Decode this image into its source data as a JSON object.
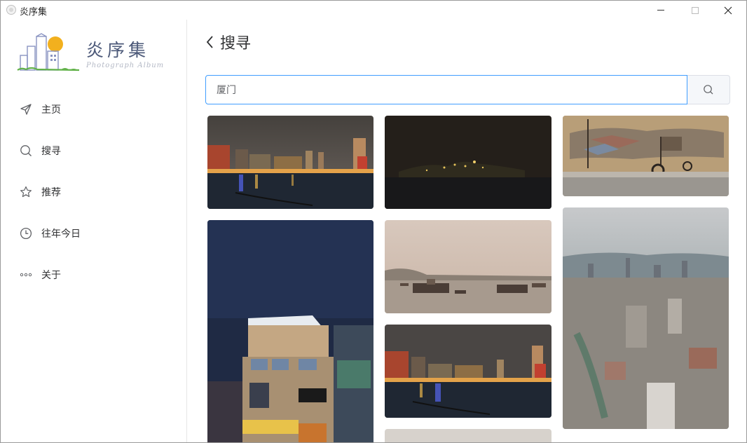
{
  "window": {
    "title": "炎序集",
    "controls": [
      "minimize",
      "maximize",
      "close"
    ]
  },
  "logo": {
    "title": "炎序集",
    "subtitle": "Photograph Album"
  },
  "sidebar": {
    "items": [
      {
        "label": "主页",
        "icon": "send-icon"
      },
      {
        "label": "搜寻",
        "icon": "search-icon"
      },
      {
        "label": "推荐",
        "icon": "star-icon"
      },
      {
        "label": "往年今日",
        "icon": "clock-icon"
      },
      {
        "label": "关于",
        "icon": "more-dots-icon"
      }
    ]
  },
  "header": {
    "back_label": "搜寻"
  },
  "search": {
    "value": "厦门",
    "placeholder": ""
  },
  "photos": [
    {
      "subject": "night harbor with lit buildings"
    },
    {
      "subject": "dark night island skyline"
    },
    {
      "subject": "stone relief wall with anchor"
    },
    {
      "subject": "night street building with signs"
    },
    {
      "subject": "boats on hazy sea"
    },
    {
      "subject": "night harbor reflections"
    },
    {
      "subject": "aerial city view from tower"
    },
    {
      "subject": "partially visible photo"
    }
  ],
  "colors": {
    "accent": "#409eff",
    "text": "#303133",
    "border": "#dcdfe6"
  }
}
